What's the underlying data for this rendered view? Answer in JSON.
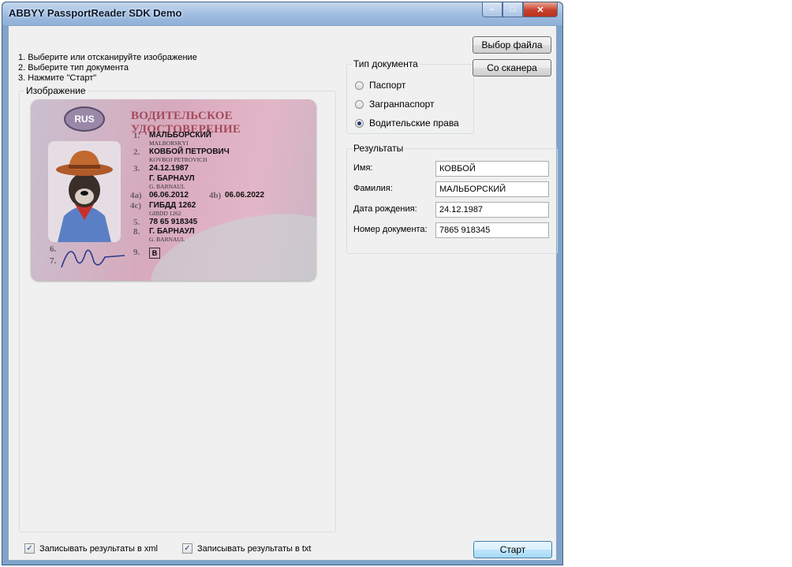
{
  "window": {
    "title": "ABBYY PassportReader SDK Demo",
    "controls": {
      "minimize": "–",
      "maximize": "□",
      "close": "✕"
    }
  },
  "instructions": [
    "1. Выберите или отсканируйте изображение",
    "2. Выберите тип документа",
    "3. Нажмите \"Старт\""
  ],
  "image_group": {
    "title": "Изображение",
    "card": {
      "country_code": "RUS",
      "heading": "ВОДИТЕЛЬСКОЕ УДОСТОВЕРЕНИЕ",
      "fields": [
        {
          "num": "1.",
          "value": "МАЛЬБОРСКИЙ",
          "sub": "MALBORSKYI"
        },
        {
          "num": "2.",
          "value": "КОВБОЙ ПЕТРОВИЧ",
          "sub": "KOVBOJ PETROVICH"
        },
        {
          "num": "3.",
          "value": "24.12.1987",
          "sub": ""
        },
        {
          "num": "",
          "value": "Г. БАРНАУЛ",
          "sub": "G. BARNAUL"
        },
        {
          "num": "4a)",
          "value": "06.06.2012",
          "sub": ""
        },
        {
          "num": "4c)",
          "value": "ГИБДД 1262",
          "sub": "GIBDD 1262"
        },
        {
          "num": "5.",
          "value": "78 65 918345",
          "sub": ""
        },
        {
          "num": "8.",
          "value": "Г. БАРНАУЛ",
          "sub": "G. BARNAUL"
        }
      ],
      "field_4b_num": "4b)",
      "field_4b_value": "06.06.2022",
      "field_9_num": "9.",
      "category": "B",
      "field_6": "6.",
      "field_7": "7."
    }
  },
  "doc_type": {
    "title": "Тип документа",
    "options": [
      "Паспорт",
      "Загранпаспорт",
      "Водительские права"
    ],
    "selected_index": 2
  },
  "buttons": {
    "choose_file": "Выбор файла",
    "from_scanner": "Со сканера",
    "start": "Старт"
  },
  "results": {
    "title": "Результаты",
    "rows": [
      {
        "label": "Имя:",
        "value": "КОВБОЙ"
      },
      {
        "label": "Фамилия:",
        "value": "МАЛЬБОРСКИЙ"
      },
      {
        "label": "Дата рождения:",
        "value": "24.12.1987"
      },
      {
        "label": "Номер документа:",
        "value": "7865 918345"
      }
    ]
  },
  "options": {
    "save_xml": {
      "label": "Записывать результаты в xml",
      "checked": true
    },
    "save_txt": {
      "label": "Записывать результаты в txt",
      "checked": true
    }
  }
}
